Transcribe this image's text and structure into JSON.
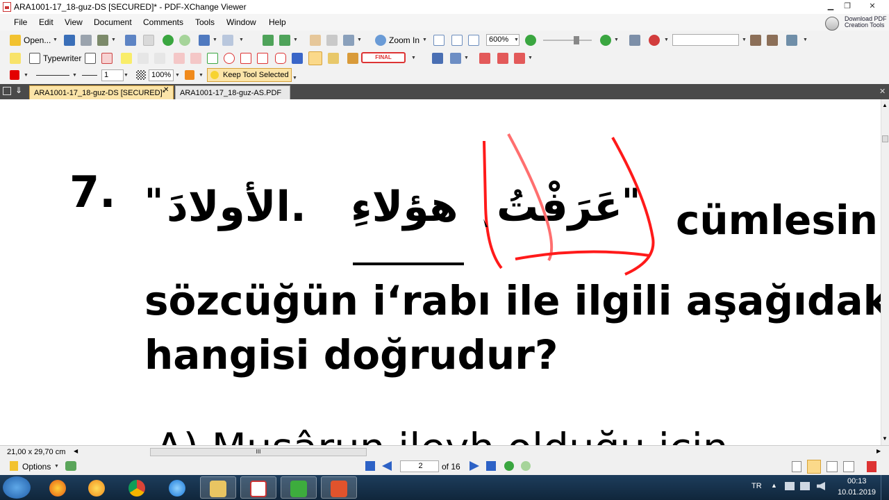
{
  "window": {
    "title": "ARA1001-17_18-guz-DS [SECURED]* - PDF-XChange Viewer",
    "controls": [
      "▁",
      "❐",
      "✕"
    ]
  },
  "menu": [
    "File",
    "Edit",
    "View",
    "Document",
    "Comments",
    "Tools",
    "Window",
    "Help"
  ],
  "download_pdf": {
    "line1": "Download PDF",
    "line2": "Creation Tools"
  },
  "toolbar1": {
    "open_label": "Open...",
    "zoom_in_label": "Zoom In",
    "zoom_value": "600%"
  },
  "toolbar2": {
    "typewriter_label": "Typewriter",
    "final_stamp": "FINAL"
  },
  "toolbar3": {
    "line_width": "1",
    "opacity": "100%",
    "keep_tool_label": "Keep Tool Selected"
  },
  "tabs": [
    {
      "label": "ARA1001-17_18-guz-DS [SECURED]*",
      "active": true
    },
    {
      "label": "ARA1001-17_18-guz-AS.PDF",
      "active": false
    }
  ],
  "document": {
    "question_number": "7.",
    "open_quote": "\"",
    "arabic_phrase": "عَرَفْتُ هؤلاءِ الأولادَ.",
    "close_quote": "\"",
    "arabic_word_1": "الأولادَ.",
    "arabic_word_2": "هؤلاءِ",
    "arabic_word_3": "عَرَفْتُ",
    "line1_rest": "cümlesin",
    "line2": "sözcüğün i‘rabı ile ilgili aşağıdak",
    "line3": "hangisi doğrudur?",
    "option_a": "A)  Muşârun  ileyh  olduğu  için"
  },
  "status": {
    "page_size": "21,00 x 29,70 cm",
    "scroll_marker": "III"
  },
  "navigation": {
    "options_label": "Options",
    "current_page": "2",
    "page_count": "of 16"
  },
  "taskbar": {
    "language": "TR",
    "time": "00:13",
    "date": "10.01.2019"
  },
  "colors": {
    "annotation_red": "#ff1a1a",
    "tab_active": "#fbe4a8",
    "taskbar": "#1d3d5c"
  }
}
